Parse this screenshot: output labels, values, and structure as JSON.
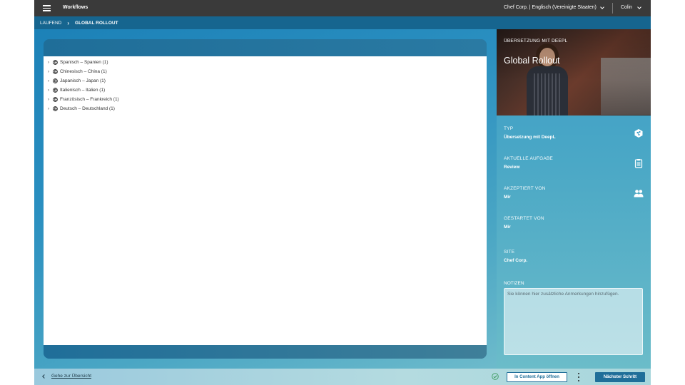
{
  "topbar": {
    "menu_icon": "hamburger-icon",
    "title": "Workflows",
    "site_locale": "Chef Corp. | Englisch (Vereinigte Staaten)",
    "user": "Colin"
  },
  "breadcrumb": {
    "parent": "LAUFEND",
    "current": "GLOBAL ROLLOUT"
  },
  "tree": {
    "items": [
      {
        "label": "Spanisch – Spanien (1)"
      },
      {
        "label": "Chinesisch – China (1)"
      },
      {
        "label": "Japanisch – Japan (1)"
      },
      {
        "label": "Italienisch – Italien (1)"
      },
      {
        "label": "Französisch – Frankreich (1)"
      },
      {
        "label": "Deutsch – Deutschland (1)"
      }
    ]
  },
  "side": {
    "hero_subtitle": "ÜBERSETZUNG MIT DEEPL",
    "hero_title": "Global Rollout",
    "type_label": "TYP",
    "type_value": "Übersetzung mit DeepL",
    "task_label": "AKTUELLE AUFGABE",
    "task_value": "Review",
    "accepted_label": "AKZEPTIERT VON",
    "accepted_value": "Mir",
    "started_label": "GESTARTET VON",
    "started_value": "Mir",
    "site_label": "SITE",
    "site_value": "Chef Corp.",
    "notes_label": "NOTIZEN",
    "notes_placeholder": "Sie können hier zusätzliche Anmerkungen hinzufügen."
  },
  "bottombar": {
    "back_label": "Gehe zur Übersicht",
    "open_app_label": "In Content App öffnen",
    "next_step_label": "Nächster Schritt"
  },
  "colors": {
    "primary": "#1f6e99",
    "topbar": "#3a3a3a",
    "breadcrumb": "#16658f"
  }
}
